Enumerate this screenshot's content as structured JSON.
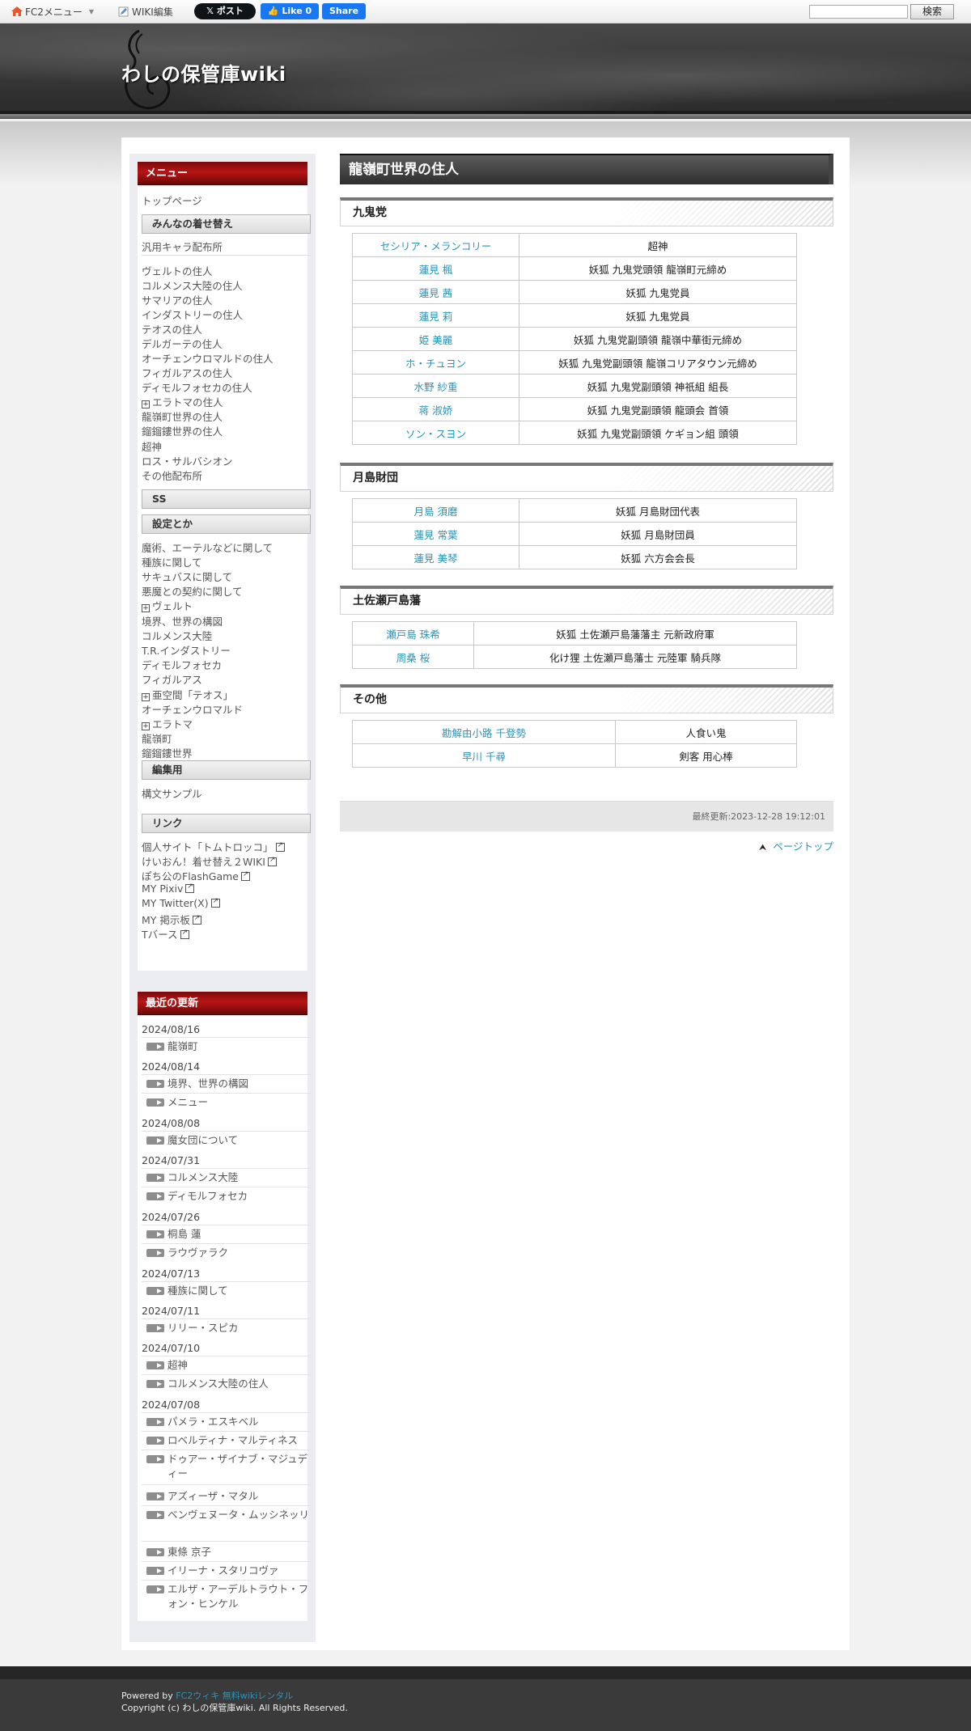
{
  "topbar": {
    "fc2_menu": "FC2メニュー",
    "wiki_edit": "WIKI編集",
    "x_post": "𝕏 ポスト",
    "fb_like": "Like 0",
    "fb_share": "Share",
    "search_value": "",
    "search_button": "検索"
  },
  "site": {
    "title": "わしの保管庫wiki"
  },
  "menu": {
    "title": "メニュー",
    "top_page": "トップページ",
    "h_kisekae": "みんなの着せ替え",
    "item_chara": "汎用キャラ配布所",
    "group1": [
      "ヴェルトの住人",
      "コルメンス大陸の住人",
      "サマリアの住人",
      "インダストリーの住人",
      "テオスの住人",
      "デルガーテの住人",
      "オーチェンウロマルドの住人",
      "フィガルアスの住人",
      "ディモルフォセカの住人"
    ],
    "eratoma": "エラトマの住人",
    "group2": [
      "龍嶺町世界の住人",
      "鎦鎦鏤世界の住人",
      "超神",
      "ロス・サルバシオン",
      "その他配布所"
    ],
    "h_ss": "SS",
    "h_settei": "設定とか",
    "group3": [
      "魔術、エーテルなどに関して",
      "種族に関して",
      "サキュバスに関して",
      "悪魔との契約に関して"
    ],
    "velt": "ヴェルト",
    "group4": [
      "境界、世界の構図",
      "コルメンス大陸",
      "T.R.インダストリー",
      "ディモルフォセカ",
      "フィガルアス"
    ],
    "akukan": "亜空間「テオス」",
    "ochen": "オーチェンウロマルド",
    "eratoma2": "エラトマ",
    "group5": [
      "龍嶺町",
      "鎦鎦鏤世界"
    ],
    "h_henshu": "編集用",
    "kobun": "構文サンプル",
    "h_link": "リンク",
    "links": [
      "個人サイト「トムトロッコ」",
      "けいおん！着せ替え２WIKI",
      "ぽち公のFlashGame",
      "MY Pixiv",
      "MY Twitter(X)",
      "MY 掲示板",
      "Tバース"
    ]
  },
  "recent": {
    "title": "最近の更新",
    "groups": [
      {
        "date": "2024/08/16",
        "items": [
          "龍嶺町"
        ]
      },
      {
        "date": "2024/08/14",
        "items": [
          "境界、世界の構図",
          "メニュー"
        ]
      },
      {
        "date": "2024/08/08",
        "items": [
          "魔女団について"
        ]
      },
      {
        "date": "2024/07/31",
        "items": [
          "コルメンス大陸",
          "ディモルフォセカ"
        ]
      },
      {
        "date": "2024/07/26",
        "items": [
          "桐島 蓮",
          "ラウヴァラク"
        ]
      },
      {
        "date": "2024/07/13",
        "items": [
          "種族に関して"
        ]
      },
      {
        "date": "2024/07/11",
        "items": [
          "リリー・スピカ"
        ]
      },
      {
        "date": "2024/07/10",
        "items": [
          "超神",
          "コルメンス大陸の住人"
        ]
      },
      {
        "date": "2024/07/08",
        "items": [
          "パメラ・エスキベル",
          "ロベルティナ・マルティネス",
          "ドゥアー・ザイナブ・マジュディー",
          "アズィーザ・マタル",
          "ベンヴェヌータ・ムッシネッリ",
          "東條 京子",
          "イリーナ・スタリコヴァ",
          "エルザ・アーデルトラウト・フォン・ヒンケル"
        ]
      }
    ]
  },
  "main": {
    "page_title": "龍嶺町世界の住人",
    "sections": [
      {
        "heading": "九鬼党",
        "rows": [
          [
            "セシリア・メランコリー",
            "超神"
          ],
          [
            "蓮見 楓",
            "妖狐 九鬼党頭領 龍嶺町元締め"
          ],
          [
            "蓮見 茜",
            "妖狐 九鬼党員"
          ],
          [
            "蓮見 莉",
            "妖狐 九鬼党員"
          ],
          [
            "姫 美麗",
            "妖狐 九鬼党副頭領 龍嶺中華街元締め"
          ],
          [
            "ホ・チュヨン",
            "妖狐 九鬼党副頭領 龍嶺コリアタウン元締め"
          ],
          [
            "水野 紗重",
            "妖狐 九鬼党副頭領 神祇組 組長"
          ],
          [
            "蒋 淑娇",
            "妖狐 九鬼党副頭領 龍頭会 首領"
          ],
          [
            "ソン・スヨン",
            "妖狐 九鬼党副頭領 ケギョン組 頭領"
          ]
        ]
      },
      {
        "heading": "月島財団",
        "rows": [
          [
            "月島 須磨",
            "妖狐 月島財団代表"
          ],
          [
            "蓮見 常葉",
            "妖狐 月島財団員"
          ],
          [
            "蓮見 美琴",
            "妖狐 六方会会長"
          ]
        ]
      },
      {
        "heading": "土佐瀬戸島藩",
        "rows": [
          [
            "瀬戸島 珠希",
            "妖狐 土佐瀬戸島藩藩主 元新政府軍"
          ],
          [
            "周桑 桜",
            "化け狸 土佐瀬戸島藩士 元陸軍 騎兵隊"
          ]
        ]
      },
      {
        "heading": "その他",
        "rows": [
          [
            "勘解由小路 千登勢",
            "人食い鬼"
          ],
          [
            "早川 千尋",
            "剣客 用心棒"
          ]
        ]
      }
    ],
    "last_modified": "最終更新:2023-12-28 19:12:01",
    "page_top": "ページトップ"
  },
  "footer": {
    "powered_by": "Powered by ",
    "powered_link": "FC2ウィキ 無料wikiレンタル",
    "copyright": "Copyright (c) わしの保管庫wiki. All Rights Reserved."
  }
}
